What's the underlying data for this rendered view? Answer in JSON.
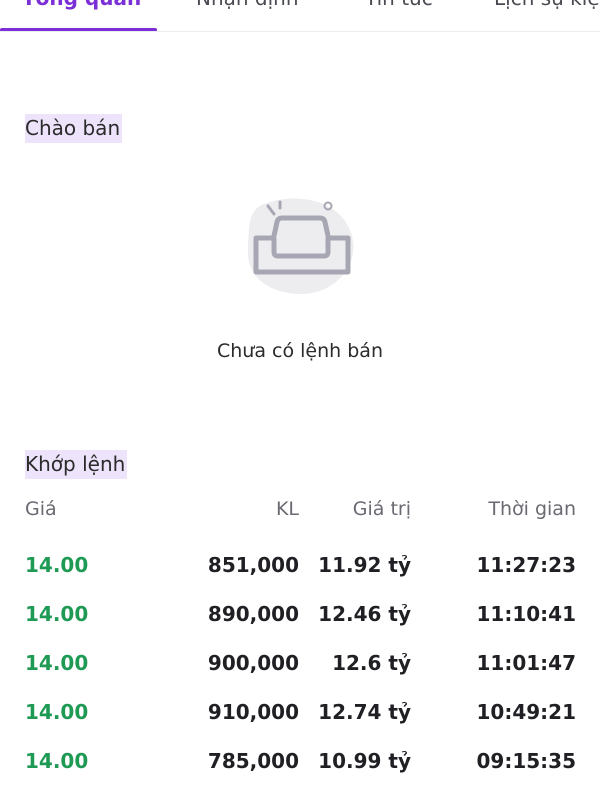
{
  "tabs": [
    {
      "label": "Tổng quan",
      "active": true
    },
    {
      "label": "Nhận định",
      "active": false
    },
    {
      "label": "Tin tức",
      "active": false
    },
    {
      "label": "Lịch sự kiệ",
      "active": false
    }
  ],
  "offers": {
    "title": "Chào bán",
    "empty_icon": "empty-inbox-icon",
    "empty_text": "Chưa có lệnh bán"
  },
  "matches": {
    "title": "Khớp lệnh",
    "headers": {
      "price": "Giá",
      "volume": "KL",
      "value": "Giá trị",
      "time": "Thời gian"
    },
    "rows": [
      {
        "price": "14.00",
        "volume": "851,000",
        "value": "11.92 tỷ",
        "time": "11:27:23"
      },
      {
        "price": "14.00",
        "volume": "890,000",
        "value": "12.46 tỷ",
        "time": "11:10:41"
      },
      {
        "price": "14.00",
        "volume": "900,000",
        "value": "12.6 tỷ",
        "time": "11:01:47"
      },
      {
        "price": "14.00",
        "volume": "910,000",
        "value": "12.74 tỷ",
        "time": "10:49:21"
      },
      {
        "price": "14.00",
        "volume": "785,000",
        "value": "10.99 tỷ",
        "time": "09:15:35"
      }
    ]
  },
  "colors": {
    "accent": "#7b2fd6",
    "up": "#1f9a55",
    "highlight": "#ede3fb"
  }
}
